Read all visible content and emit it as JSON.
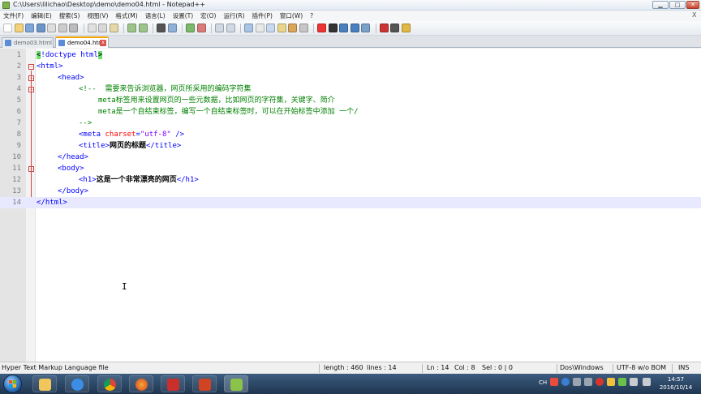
{
  "window": {
    "title": "C:\\Users\\lilichao\\Desktop\\demo\\demo04.html - Notepad++",
    "min": "▁",
    "max": "□",
    "close": "✕"
  },
  "menu": [
    "文件(F)",
    "编辑(E)",
    "搜索(S)",
    "视图(V)",
    "格式(M)",
    "语言(L)",
    "设置(T)",
    "宏(O)",
    "运行(R)",
    "插件(P)",
    "窗口(W)",
    "?"
  ],
  "menu_close": "X",
  "tabs": [
    {
      "label": "demo03.html",
      "active": false
    },
    {
      "label": "demo04.html",
      "active": true
    }
  ],
  "editor": {
    "line_numbers": [
      "1",
      "2",
      "3",
      "4",
      "5",
      "6",
      "7",
      "8",
      "9",
      "10",
      "11",
      "12",
      "13",
      "14"
    ],
    "lines": {
      "l1": {
        "a": "<",
        "b": "!doctype html",
        "c": ">"
      },
      "l2": {
        "a": "<html>"
      },
      "l3": {
        "a": "<head>"
      },
      "l4": {
        "a": "<!--  需要来告诉浏览器，网页所采用的编码字符集"
      },
      "l5": {
        "a": "meta标签用来设置网页的一些元数据，比如网页的字符集，关键字、简介"
      },
      "l6": {
        "a": "meta是一个自结束标签，编写一个自结束标签时，可以在开始标签中添加 一个/"
      },
      "l7": {
        "a": "-->"
      },
      "l8": {
        "a": "<meta ",
        "b": "charset",
        "c": "=",
        "d": "\"utf-8\"",
        "e": " />"
      },
      "l9": {
        "a": "<title>",
        "b": "网页的标题",
        "c": "</title>"
      },
      "l10": {
        "a": "</head>"
      },
      "l11": {
        "a": "<body>"
      },
      "l12": {
        "a": "<h1>",
        "b": "这是一个非常漂亮的网页",
        "c": "</h1>"
      },
      "l13": {
        "a": "</body>"
      },
      "l14": {
        "a": "</html>"
      }
    }
  },
  "status": {
    "file_type": "Hyper Text Markup Language file",
    "length": "length : 460",
    "lines": "lines : 14",
    "ln": "Ln : 14",
    "col": "Col : 8",
    "sel": "Sel : 0 | 0",
    "eol": "Dos\\Windows",
    "encoding": "UTF-8 w/o BOM",
    "mode": "INS"
  },
  "taskbar": {
    "apps": [
      "explorer-icon",
      "ie-icon",
      "chrome-icon",
      "firefox-icon",
      "xmind-icon",
      "powerpoint-icon",
      "notepadpp-icon"
    ],
    "lang": "CH",
    "time": "14:57",
    "date": "2016/10/14"
  },
  "colors": {
    "tag": "#0000ff",
    "attr": "#ff0000",
    "string": "#8000ff",
    "comment": "#008000",
    "current_line": "#e8e8ff"
  }
}
